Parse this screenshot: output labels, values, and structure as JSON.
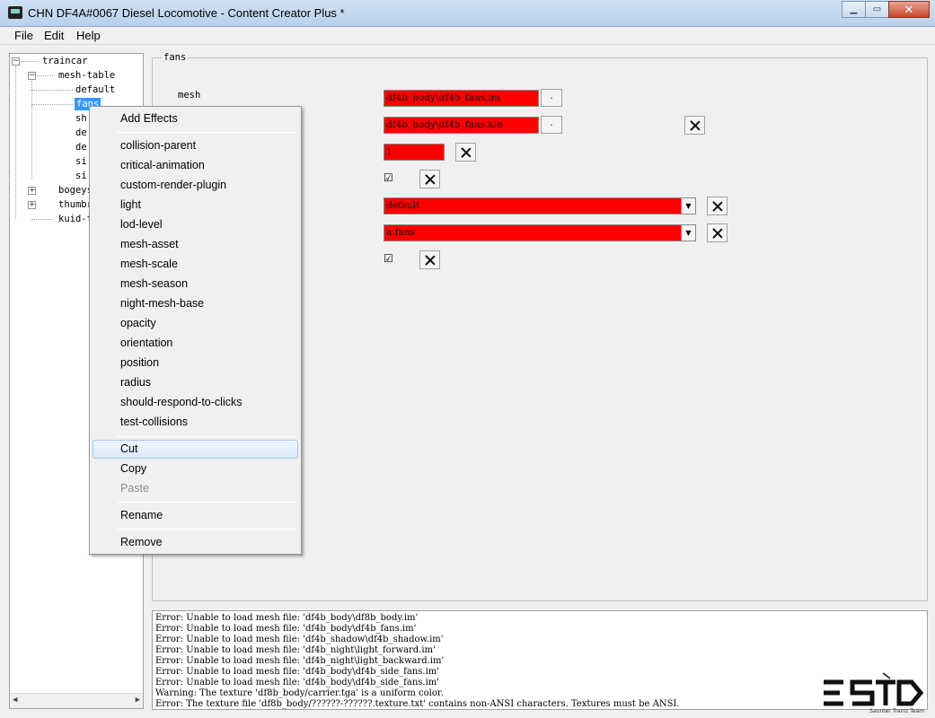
{
  "window": {
    "title": "CHN DF4A#0067 Diesel Locomotive - Content Creator Plus *",
    "controls": {
      "minimize": "▁",
      "maximize": "▭",
      "close": "✕"
    }
  },
  "menubar": {
    "items": [
      "File",
      "Edit",
      "Help"
    ]
  },
  "tree": {
    "root": "traincar",
    "mesh_table": "mesh-table",
    "children": [
      "default",
      "fans",
      "sh",
      "de",
      "de",
      "si",
      "si"
    ],
    "bogeys": "bogeys",
    "thumbnails": "thumbr",
    "kuid": "kuid-t"
  },
  "group": {
    "label": "fans"
  },
  "props": {
    "mesh_label": "mesh",
    "mesh_file": "df4b_body\\df4b_fans.im",
    "anim_file": "df4b_body\\df4b_fans.kin",
    "value_field": "1",
    "check1": "☑",
    "dropdown1": "default",
    "dropdown2": "a.fans",
    "check2": "☑",
    "browse": "."
  },
  "context_menu": {
    "header": "Add Effects",
    "effects": [
      "collision-parent",
      "critical-animation",
      "custom-render-plugin",
      "light",
      "lod-level",
      "mesh-asset",
      "mesh-scale",
      "mesh-season",
      "night-mesh-base",
      "opacity",
      "orientation",
      "position",
      "radius",
      "should-respond-to-clicks",
      "test-collisions"
    ],
    "cut": "Cut",
    "copy": "Copy",
    "paste": "Paste",
    "rename": "Rename",
    "remove": "Remove"
  },
  "log": [
    "Error: Unable to load mesh file: 'df4b_body\\df8b_body.im'",
    "Error: Unable to load mesh file: 'df4b_body\\df4b_fans.im'",
    "Error: Unable to load mesh file: 'df4b_shadow\\df4b_shadow.im'",
    "Error: Unable to load mesh file: 'df4b_night\\light_forward.im'",
    "Error: Unable to load mesh file: 'df4b_night\\light_backward.im'",
    "Error: Unable to load mesh file: 'df4b_body\\df4b_side_fans.im'",
    "Error: Unable to load mesh file: 'df4b_body\\df4b_side_fans.im'",
    "Warning: The texture 'df8b_body/carrier.tga' is a uniform color.",
    "Error: The texture file 'df8b_body/??????-??????.texture.txt' contains non-ANSI characters. Textures must be ANSI."
  ],
  "logo": {
    "caption": "Saunter Trainz Team"
  }
}
